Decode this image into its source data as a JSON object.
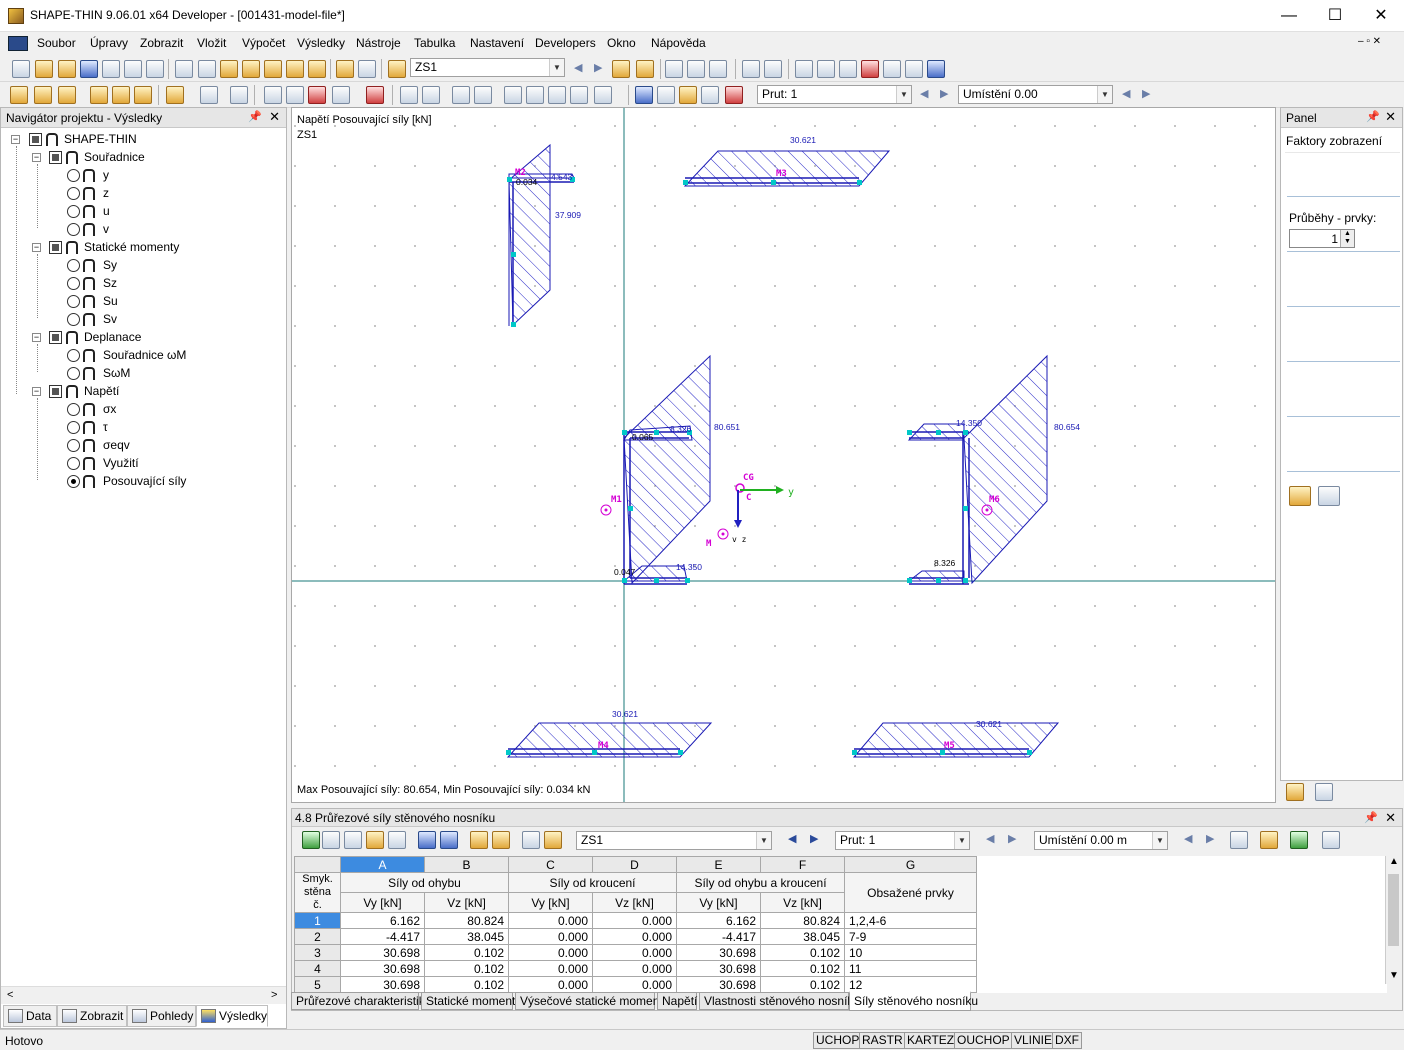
{
  "window": {
    "title": "SHAPE-THIN 9.06.01 x64 Developer - [001431-model-file*]",
    "minimize": "—",
    "maximize": "☐",
    "close": "✕"
  },
  "menu": [
    "Soubor",
    "Úpravy",
    "Zobrazit",
    "Vložit",
    "Výpočet",
    "Výsledky",
    "Nástroje",
    "Tabulka",
    "Nastavení",
    "Developers",
    "Okno",
    "Nápověda"
  ],
  "toolbar1": {
    "loadcase": "ZS1"
  },
  "toolbar2": {
    "member": "Prut: 1",
    "location": "Umístění 0.00"
  },
  "navigator": {
    "title": "Navigátor projektu - Výsledky",
    "root": "SHAPE-THIN",
    "groups": [
      {
        "label": "Souřadnice",
        "items": [
          "y",
          "z",
          "u",
          "v"
        ]
      },
      {
        "label": "Statické momenty",
        "items": [
          "Sy",
          "Sz",
          "Su",
          "Sv"
        ]
      },
      {
        "label": "Deplanace",
        "items": [
          "Souřadnice ωM",
          "SωM"
        ]
      },
      {
        "label": "Napětí",
        "items": [
          "σx",
          "τ",
          "σeqv",
          "Využití",
          "Posouvající síly"
        ]
      }
    ],
    "selected": "Posouvající síly",
    "tabs": [
      "Data",
      "Zobrazit",
      "Pohledy",
      "Výsledky"
    ],
    "active_tab": "Výsledky"
  },
  "canvas": {
    "heading1": "Napětí Posouvající síly [kN]",
    "heading2": "ZS1",
    "footer": "Max Posouvající síly: 80.654, Min Posouvající síly: 0.034 kN",
    "labels": {
      "m2_a": "4.543",
      "m2_b": "0.034",
      "m2_c": "37.909",
      "m3": "30.621",
      "m1_a": "8.326",
      "m1_b": "0.065",
      "m1_c": "80.651",
      "m1_d": "0.047",
      "m1_e": "14.350",
      "m6_a": "14.350",
      "m6_b": "80.654",
      "m6_c": "8.326",
      "m4": "30.621",
      "m5": "30.621",
      "n_m1": "M1",
      "n_m2": "M2",
      "n_m3": "M3",
      "n_m4": "M4",
      "n_m5": "M5",
      "n_m6": "M6",
      "cg": "CG",
      "c": "C",
      "m": "M",
      "y": "y",
      "vz": "v z"
    }
  },
  "right_panel": {
    "title": "Panel",
    "section1": "Faktory zobrazení",
    "section2": "Průběhy - prvky:",
    "spin_value": "1"
  },
  "table_panel": {
    "title": "4.8 Průřezové síly stěnového nosníku",
    "loadcase": "ZS1",
    "member": "Prut: 1",
    "location": "Umístění 0.00 m",
    "col_letters": [
      "A",
      "B",
      "C",
      "D",
      "E",
      "F",
      "G"
    ],
    "group_headers": [
      "Smyk. stěna č.",
      "Síly od ohybu",
      "Síly od kroucení",
      "Síly od ohybu a kroucení",
      "Obsažené prvky"
    ],
    "sub_headers": [
      "Vy [kN]",
      "Vz [kN]",
      "Vy [kN]",
      "Vz [kN]",
      "Vy [kN]",
      "Vz [kN]"
    ],
    "rows": [
      [
        "1",
        "6.162",
        "80.824",
        "0.000",
        "0.000",
        "6.162",
        "80.824",
        "1,2,4-6"
      ],
      [
        "2",
        "-4.417",
        "38.045",
        "0.000",
        "0.000",
        "-4.417",
        "38.045",
        "7-9"
      ],
      [
        "3",
        "30.698",
        "0.102",
        "0.000",
        "0.000",
        "30.698",
        "0.102",
        "10"
      ],
      [
        "4",
        "30.698",
        "0.102",
        "0.000",
        "0.000",
        "30.698",
        "0.102",
        "11"
      ],
      [
        "5",
        "30.698",
        "0.102",
        "0.000",
        "0.000",
        "30.698",
        "0.102",
        "12"
      ]
    ],
    "sheet_tabs": [
      "Průřezové charakteristiky",
      "Statické momenty",
      "Výsečové statické momenty",
      "Napětí",
      "Vlastnosti stěnového nosníku",
      "Síly stěnového nosníku"
    ],
    "active_sheet": "Síly stěnového nosníku"
  },
  "status": {
    "text": "Hotovo",
    "buttons": [
      "UCHOP",
      "RASTR",
      "KARTEZ",
      "OUCHOP",
      "VLINIE",
      "DXF"
    ]
  },
  "colors": {
    "accent": "#3d8be0",
    "diagram": "#1a1ab4",
    "axis": "#1a7a7a",
    "node": "#00c8c8",
    "member_label": "#d400d4"
  }
}
